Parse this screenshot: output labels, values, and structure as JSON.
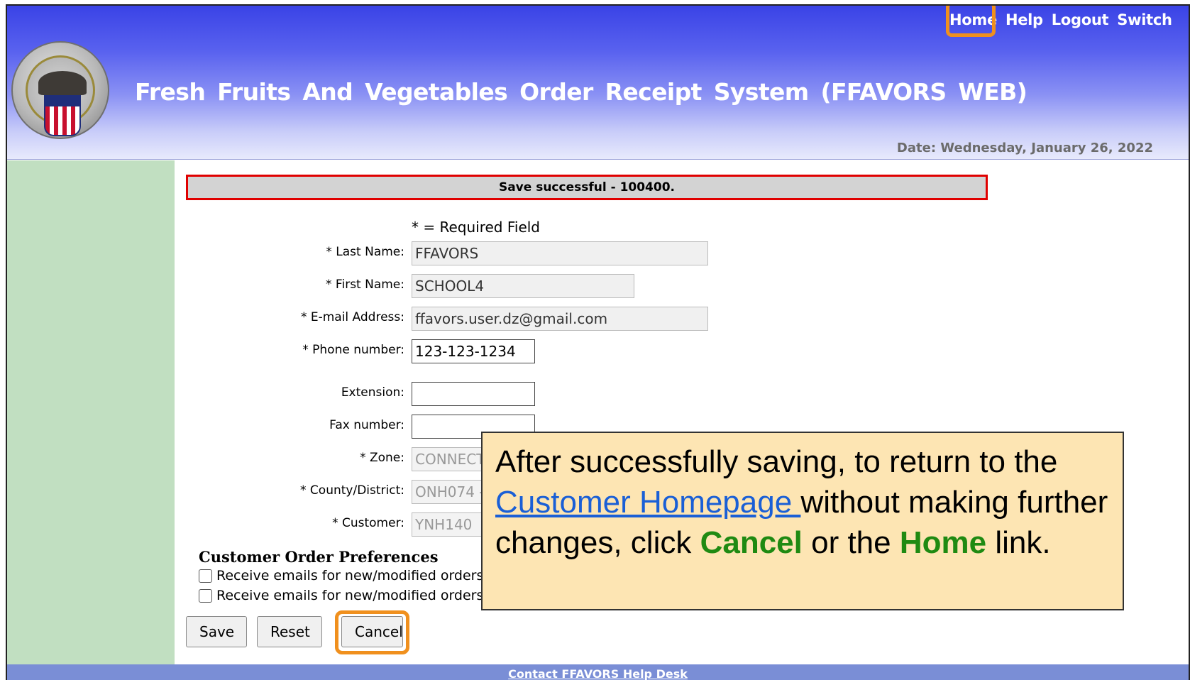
{
  "header": {
    "links": [
      "Home",
      "Help",
      "Logout",
      "Switch"
    ],
    "title": "Fresh Fruits And Vegetables Order Receipt System (FFAVORS WEB)",
    "date": "Date: Wednesday, January 26, 2022"
  },
  "banner": "Save successful - 100400.",
  "required_note": "* = Required Field",
  "form": {
    "last_name_label": "* Last Name:",
    "last_name_value": "FFAVORS",
    "first_name_label": "* First Name:",
    "first_name_value": "SCHOOL4",
    "email_label": "* E-mail Address:",
    "email_value": "ffavors.user.dz@gmail.com",
    "phone_label": "* Phone number:",
    "phone_value": "123-123-1234",
    "extension_label": "Extension:",
    "extension_value": "",
    "fax_label": "Fax number:",
    "fax_value": "",
    "zone_label": "* Zone:",
    "zone_value": "CONNECTICUT",
    "county_label": "* County/District:",
    "county_value": "ONH074 - ",
    "customer_label": "* Customer:",
    "customer_value": "YNH140"
  },
  "prefs": {
    "title": "Customer Order Preferences",
    "option1": "Receive emails for new/modified orders",
    "option2": "Receive emails for new/modified orders"
  },
  "buttons": {
    "save": "Save",
    "reset": "Reset",
    "cancel": "Cancel"
  },
  "callout": {
    "line_start": "After successfully saving, to return to the",
    "link": "Customer Homepage ",
    "after_link": "without making further changes, click ",
    "cancel": "Cancel",
    "or_the": " or the",
    "home": "Home",
    "end": " link."
  },
  "footer": {
    "link": "Contact FFAVORS Help Desk"
  },
  "colors": {
    "highlight": "#f0901e",
    "accent_green": "#1f8a12",
    "header_blue": "#3a43e6",
    "nav_green": "#c1dfc1"
  }
}
